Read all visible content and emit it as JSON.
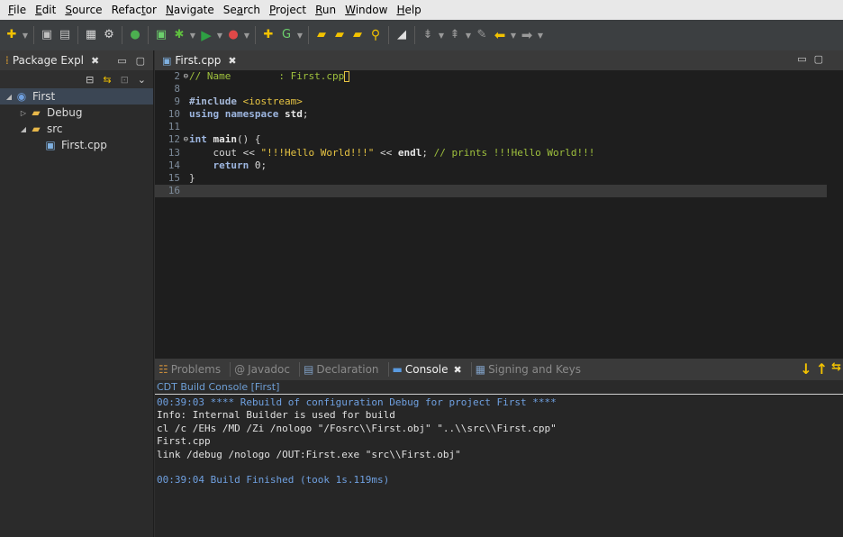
{
  "menu": [
    {
      "pre": "",
      "ul": "F",
      "post": "ile"
    },
    {
      "pre": "",
      "ul": "E",
      "post": "dit"
    },
    {
      "pre": "",
      "ul": "S",
      "post": "ource"
    },
    {
      "pre": "Refac",
      "ul": "t",
      "post": "or"
    },
    {
      "pre": "",
      "ul": "N",
      "post": "avigate"
    },
    {
      "pre": "Se",
      "ul": "a",
      "post": "rch"
    },
    {
      "pre": "",
      "ul": "P",
      "post": "roject"
    },
    {
      "pre": "",
      "ul": "R",
      "post": "un"
    },
    {
      "pre": "",
      "ul": "W",
      "post": "indow"
    },
    {
      "pre": "",
      "ul": "H",
      "post": "elp"
    }
  ],
  "colors": {
    "accent_yellow": "#f2c200",
    "keyword": "#9db6e0",
    "string": "#e7c443",
    "comment": "#9fc13d",
    "console_blue": "#6fa0e0",
    "selection": "#3b4654"
  },
  "left_pane": {
    "tab_title": "Package Expl",
    "tree": [
      {
        "label": "First",
        "icon": "cpp-project-icon",
        "depth": 0,
        "twisty": "expanded"
      },
      {
        "label": "Debug",
        "icon": "folder-icon",
        "depth": 1,
        "twisty": "collapsed"
      },
      {
        "label": "src",
        "icon": "source-folder-icon",
        "depth": 1,
        "twisty": "expanded"
      },
      {
        "label": "First.cpp",
        "icon": "cpp-file-icon",
        "depth": 2,
        "twisty": "none"
      }
    ]
  },
  "editor": {
    "tab_title": "First.cpp",
    "lines": [
      {
        "n": "2",
        "fold": true,
        "tokens": [
          {
            "t": "cm",
            "v": "// Name        : First.cpp"
          },
          {
            "t": "cursor",
            "v": ""
          }
        ]
      },
      {
        "n": "8",
        "tokens": []
      },
      {
        "n": "9",
        "tokens": [
          {
            "t": "pp",
            "v": "#include"
          },
          {
            "t": "plain",
            "v": " "
          },
          {
            "t": "inc",
            "v": "<iostream>"
          }
        ]
      },
      {
        "n": "10",
        "tokens": [
          {
            "t": "kw",
            "v": "using"
          },
          {
            "t": "plain",
            "v": " "
          },
          {
            "t": "kw",
            "v": "namespace"
          },
          {
            "t": "plain",
            "v": " "
          },
          {
            "t": "id",
            "v": "std"
          },
          {
            "t": "plain",
            "v": ";"
          }
        ]
      },
      {
        "n": "11",
        "tokens": []
      },
      {
        "n": "12",
        "fold": true,
        "tokens": [
          {
            "t": "kw",
            "v": "int"
          },
          {
            "t": "plain",
            "v": " "
          },
          {
            "t": "id",
            "v": "main"
          },
          {
            "t": "plain",
            "v": "() {"
          }
        ]
      },
      {
        "n": "13",
        "tokens": [
          {
            "t": "plain",
            "v": "    cout << "
          },
          {
            "t": "str",
            "v": "\"!!!Hello World!!!\""
          },
          {
            "t": "plain",
            "v": " << "
          },
          {
            "t": "id",
            "v": "endl"
          },
          {
            "t": "plain",
            "v": "; "
          },
          {
            "t": "cm",
            "v": "// prints !!!Hello World!!!"
          }
        ]
      },
      {
        "n": "14",
        "tokens": [
          {
            "t": "plain",
            "v": "    "
          },
          {
            "t": "kw",
            "v": "return"
          },
          {
            "t": "plain",
            "v": " "
          },
          {
            "t": "num",
            "v": "0"
          },
          {
            "t": "plain",
            "v": ";"
          }
        ]
      },
      {
        "n": "15",
        "tokens": [
          {
            "t": "plain",
            "v": "}"
          }
        ]
      },
      {
        "n": "16",
        "current": true,
        "tokens": []
      }
    ]
  },
  "console": {
    "tabs": [
      {
        "label": "Problems",
        "icon": "problems-icon",
        "active": false
      },
      {
        "label": "Javadoc",
        "icon": "javadoc-icon",
        "active": false
      },
      {
        "label": "Declaration",
        "icon": "declaration-icon",
        "active": false
      },
      {
        "label": "Console",
        "icon": "console-icon",
        "active": true
      },
      {
        "label": "Signing and Keys",
        "icon": "signing-keys-icon",
        "active": false
      }
    ],
    "label": "CDT Build Console [First]",
    "lines": [
      {
        "text": "00:39:03 **** Rebuild of configuration Debug for project First ****",
        "style": "blue"
      },
      {
        "text": "Info: Internal Builder is used for build",
        "style": "normal"
      },
      {
        "text": "cl /c /EHs /MD /Zi /nologo \"/Fosrc\\\\First.obj\" \"..\\\\src\\\\First.cpp\"",
        "style": "normal"
      },
      {
        "text": "First.cpp",
        "style": "normal"
      },
      {
        "text": "link /debug /nologo /OUT:First.exe \"src\\\\First.obj\"",
        "style": "normal"
      },
      {
        "text": "",
        "style": "normal"
      },
      {
        "text": "00:39:04 Build Finished (took 1s.119ms)",
        "style": "blue"
      }
    ]
  }
}
